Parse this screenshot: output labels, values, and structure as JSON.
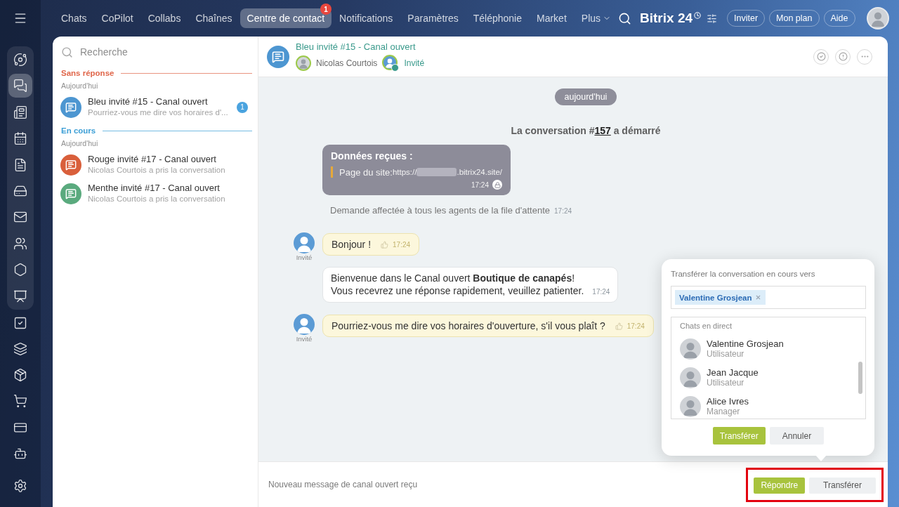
{
  "sidebar": {
    "items": [
      {
        "selected": false
      },
      {
        "selected": true
      },
      {
        "selected": false
      },
      {
        "selected": false
      },
      {
        "selected": false
      },
      {
        "selected": false
      },
      {
        "selected": false
      },
      {
        "selected": false
      },
      {
        "selected": false
      },
      {
        "selected": false
      },
      {
        "selected": false
      },
      {
        "selected": false
      },
      {
        "selected": false
      },
      {
        "selected": false
      },
      {
        "selected": false
      },
      {
        "selected": false
      }
    ]
  },
  "top_nav": {
    "tabs": [
      {
        "label": "Chats",
        "selected": false,
        "kind": "link"
      },
      {
        "label": "CoPilot",
        "selected": false,
        "kind": "link"
      },
      {
        "label": "Collabs",
        "selected": false,
        "kind": "link"
      },
      {
        "label": "Chaînes",
        "selected": false,
        "kind": "link"
      },
      {
        "label": "Centre de contact",
        "selected": true,
        "kind": "link",
        "badge": "1"
      },
      {
        "label": "Notifications",
        "selected": false,
        "kind": "link"
      },
      {
        "label": "Paramètres",
        "selected": false,
        "kind": "link"
      },
      {
        "label": "Téléphonie",
        "selected": false,
        "kind": "link"
      },
      {
        "label": "Market",
        "selected": false,
        "kind": "link"
      },
      {
        "label": "Plus",
        "selected": false,
        "kind": "menu"
      }
    ],
    "brand": "Bitrix 24",
    "buttons": [
      "Inviter",
      "Mon plan",
      "Aide"
    ]
  },
  "conversation_list": {
    "search": {
      "placeholder": "Recherche"
    },
    "groups": [
      {
        "title": "Sans réponse",
        "color": "#e0674b",
        "date": "Aujourd'hui",
        "items": [
          {
            "title": "Bleu invité #15 - Canal ouvert",
            "preview": "Pourriez-vous me dire vos horaires d'...",
            "color": "#4d96d1",
            "badge": "1",
            "selected": false
          }
        ]
      },
      {
        "title": "En cours",
        "color": "#3d9fd6",
        "date": "Aujourd'hui",
        "items": [
          {
            "title": "Rouge invité #17 - Canal ouvert",
            "preview": "Nicolas Courtois a pris la conversation",
            "color": "#d95f3b",
            "selected": false
          },
          {
            "title": "Menthe invité #17 - Canal ouvert",
            "preview": "Nicolas Courtois a pris la conversation",
            "color": "#5aaa7e",
            "selected": false
          }
        ]
      }
    ]
  },
  "chat": {
    "title": "Bleu invité #15 - Canal ouvert",
    "members": [
      {
        "name": "Nicolas Courtois",
        "kind": "operator"
      },
      {
        "name": "Invité",
        "kind": "guest"
      }
    ]
  },
  "messages": [
    {
      "kind": "date",
      "text": "aujourd'hui"
    },
    {
      "kind": "system",
      "text_before": "La conversation #",
      "link": "157",
      "text_after": " a démarré"
    },
    {
      "kind": "form",
      "title": "Données reçues :",
      "label": "Page du site:",
      "url_start": "https://",
      "url_end": ".bitrix24.site/",
      "time": "17:24"
    },
    {
      "kind": "notice",
      "text": "Demande affectée à tous les agents de la file d'attente",
      "time": "17:24"
    },
    {
      "kind": "guest",
      "author": "Invité",
      "text": "Bonjour !",
      "time": "17:24"
    },
    {
      "kind": "bot",
      "lines": [
        "Bienvenue dans le Canal ouvert **Boutique de canapés**!",
        "Vous recevrez une réponse rapidement, veuillez patienter."
      ],
      "time": "17:24"
    },
    {
      "kind": "guest",
      "author": "Invité",
      "text": "Pourriez-vous me dire vos horaires d'ouverture, s'il vous plaît ?",
      "time": "17:24"
    }
  ],
  "transfer_popup": {
    "title": "Transférer la conversation en cours vers",
    "recipients": [
      "Valentine Grosjean"
    ],
    "list_title": "Chats en direct",
    "users": [
      {
        "name": "Valentine Grosjean",
        "role": "Utilisateur"
      },
      {
        "name": "Jean Jacque",
        "role": "Utilisateur"
      },
      {
        "name": "Alice Ivres",
        "role": "Manager"
      }
    ],
    "buttons": [
      {
        "label": "Transférer",
        "kind": "primary"
      },
      {
        "label": "Annuler",
        "kind": "secondary"
      }
    ]
  },
  "footer": {
    "status": "Nouveau message de canal ouvert reçu",
    "highlighted": true,
    "buttons": [
      {
        "label": "Répondre",
        "kind": "primary"
      },
      {
        "label": "Transférer",
        "kind": "secondary"
      }
    ]
  }
}
